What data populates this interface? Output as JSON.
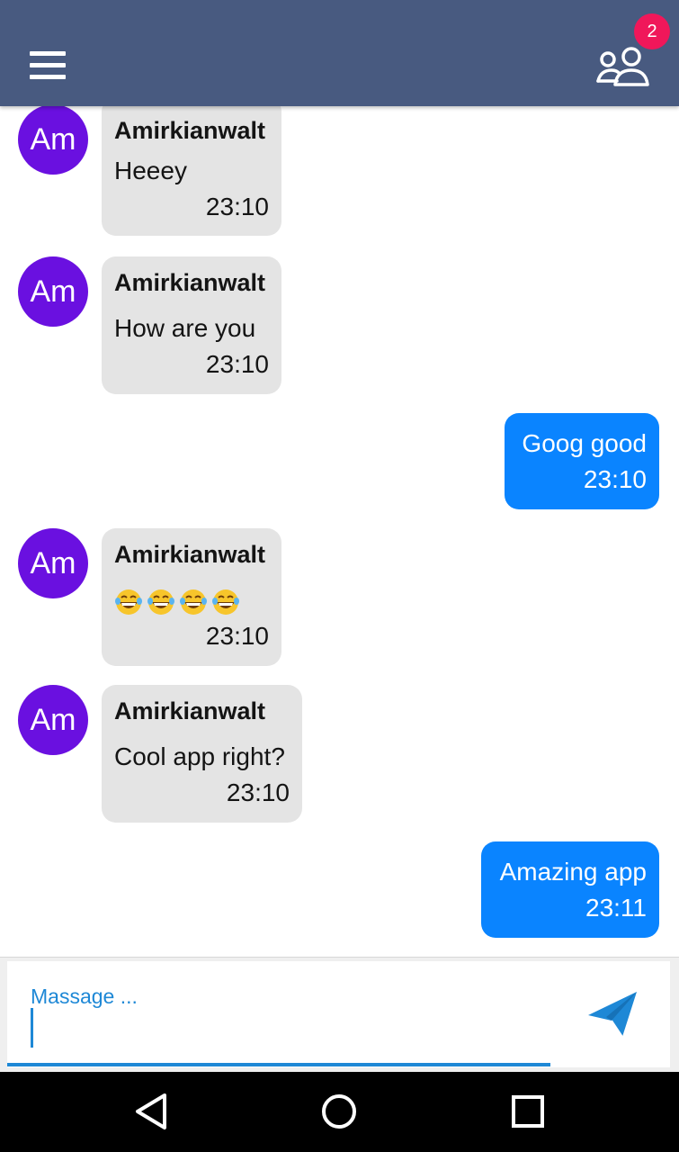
{
  "header": {
    "menu_icon": "hamburger-menu-icon",
    "users_icon": "users-group-icon",
    "badge_count": "2",
    "colors": {
      "bar": "#485a80",
      "badge": "#f0175a"
    }
  },
  "messages": [
    {
      "direction": "incoming",
      "avatar": "Am",
      "sender": "Amirkianwalt",
      "text": "Heeey",
      "time": "23:10"
    },
    {
      "direction": "incoming",
      "avatar": "Am",
      "sender": "Amirkianwalt",
      "text": "How are you",
      "time": "23:10"
    },
    {
      "direction": "outgoing",
      "text": "Goog good",
      "time": "23:10"
    },
    {
      "direction": "incoming",
      "avatar": "Am",
      "sender": "Amirkianwalt",
      "text": "",
      "emoji": "tears-of-joy-emoji",
      "emoji_count": 4,
      "time": "23:10"
    },
    {
      "direction": "incoming",
      "avatar": "Am",
      "sender": "Amirkianwalt",
      "text": "Cool app right?",
      "time": "23:10"
    },
    {
      "direction": "outgoing",
      "text": "Amazing app",
      "time": "23:11"
    }
  ],
  "composer": {
    "placeholder": "Massage ...",
    "value": "",
    "send_icon": "send-paper-plane-icon",
    "accent": "#1e88d6"
  },
  "navbar": {
    "back_icon": "back-triangle-icon",
    "home_icon": "home-circle-icon",
    "recents_icon": "recents-square-icon"
  },
  "colors": {
    "avatar": "#6a10e0",
    "incoming_bubble": "#e4e4e4",
    "outgoing_bubble": "#0a84ff"
  }
}
